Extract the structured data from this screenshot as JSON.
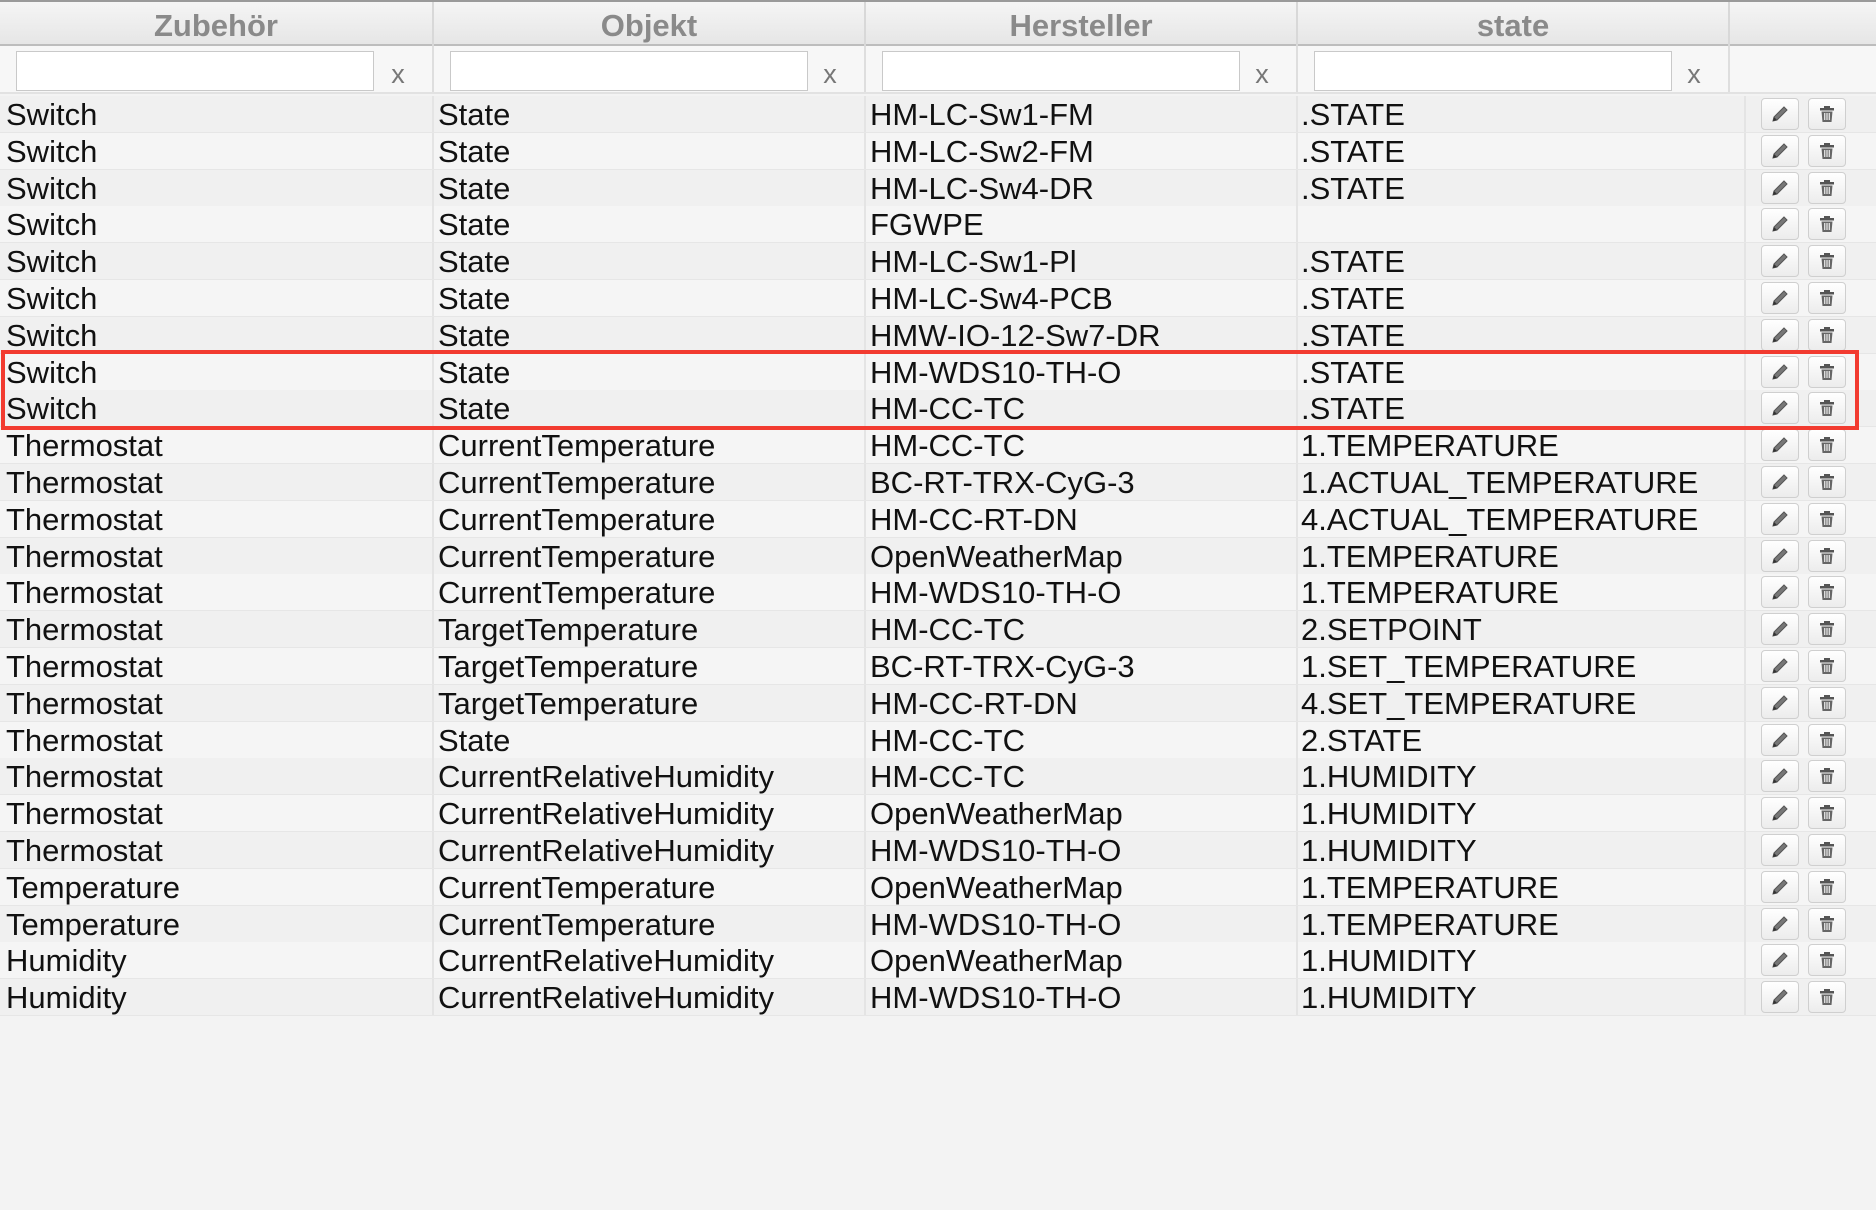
{
  "table": {
    "columns": [
      {
        "label": "Zubehör"
      },
      {
        "label": "Objekt"
      },
      {
        "label": "Hersteller"
      },
      {
        "label": "state"
      }
    ],
    "filters": [
      {
        "value": "",
        "clear_label": "x"
      },
      {
        "value": "",
        "clear_label": "x"
      },
      {
        "value": "",
        "clear_label": "x"
      },
      {
        "value": "",
        "clear_label": "x"
      }
    ],
    "rows": [
      [
        "Switch",
        "State",
        "HM-LC-Sw1-FM",
        ".STATE"
      ],
      [
        "Switch",
        "State",
        "HM-LC-Sw2-FM",
        ".STATE"
      ],
      [
        "Switch",
        "State",
        "HM-LC-Sw4-DR",
        ".STATE"
      ],
      [
        "Switch",
        "State",
        "FGWPE",
        ""
      ],
      [
        "Switch",
        "State",
        "HM-LC-Sw1-Pl",
        ".STATE"
      ],
      [
        "Switch",
        "State",
        "HM-LC-Sw4-PCB",
        ".STATE"
      ],
      [
        "Switch",
        "State",
        "HMW-IO-12-Sw7-DR",
        ".STATE"
      ],
      [
        "Switch",
        "State",
        "HM-WDS10-TH-O",
        ".STATE"
      ],
      [
        "Switch",
        "State",
        "HM-CC-TC",
        ".STATE"
      ],
      [
        "Thermostat",
        "CurrentTemperature",
        "HM-CC-TC",
        "1.TEMPERATURE"
      ],
      [
        "Thermostat",
        "CurrentTemperature",
        "BC-RT-TRX-CyG-3",
        "1.ACTUAL_TEMPERATURE"
      ],
      [
        "Thermostat",
        "CurrentTemperature",
        "HM-CC-RT-DN",
        "4.ACTUAL_TEMPERATURE"
      ],
      [
        "Thermostat",
        "CurrentTemperature",
        "OpenWeatherMap",
        "1.TEMPERATURE"
      ],
      [
        "Thermostat",
        "CurrentTemperature",
        "HM-WDS10-TH-O",
        "1.TEMPERATURE"
      ],
      [
        "Thermostat",
        "TargetTemperature",
        "HM-CC-TC",
        "2.SETPOINT"
      ],
      [
        "Thermostat",
        "TargetTemperature",
        "BC-RT-TRX-CyG-3",
        "1.SET_TEMPERATURE"
      ],
      [
        "Thermostat",
        "TargetTemperature",
        "HM-CC-RT-DN",
        "4.SET_TEMPERATURE"
      ],
      [
        "Thermostat",
        "State",
        "HM-CC-TC",
        "2.STATE"
      ],
      [
        "Thermostat",
        "CurrentRelativeHumidity",
        "HM-CC-TC",
        "1.HUMIDITY"
      ],
      [
        "Thermostat",
        "CurrentRelativeHumidity",
        "OpenWeatherMap",
        "1.HUMIDITY"
      ],
      [
        "Thermostat",
        "CurrentRelativeHumidity",
        "HM-WDS10-TH-O",
        "1.HUMIDITY"
      ],
      [
        "Temperature",
        "CurrentTemperature",
        "OpenWeatherMap",
        "1.TEMPERATURE"
      ],
      [
        "Temperature",
        "CurrentTemperature",
        "HM-WDS10-TH-O",
        "1.TEMPERATURE"
      ],
      [
        "Humidity",
        "CurrentRelativeHumidity",
        "OpenWeatherMap",
        "1.HUMIDITY"
      ],
      [
        "Humidity",
        "CurrentRelativeHumidity",
        "HM-WDS10-TH-O",
        "1.HUMIDITY"
      ]
    ],
    "row_actions": {
      "edit_icon": "pencil-icon",
      "delete_icon": "trash-icon"
    },
    "highlight": {
      "rows": [
        7,
        8
      ],
      "color": "#f23b30"
    }
  }
}
